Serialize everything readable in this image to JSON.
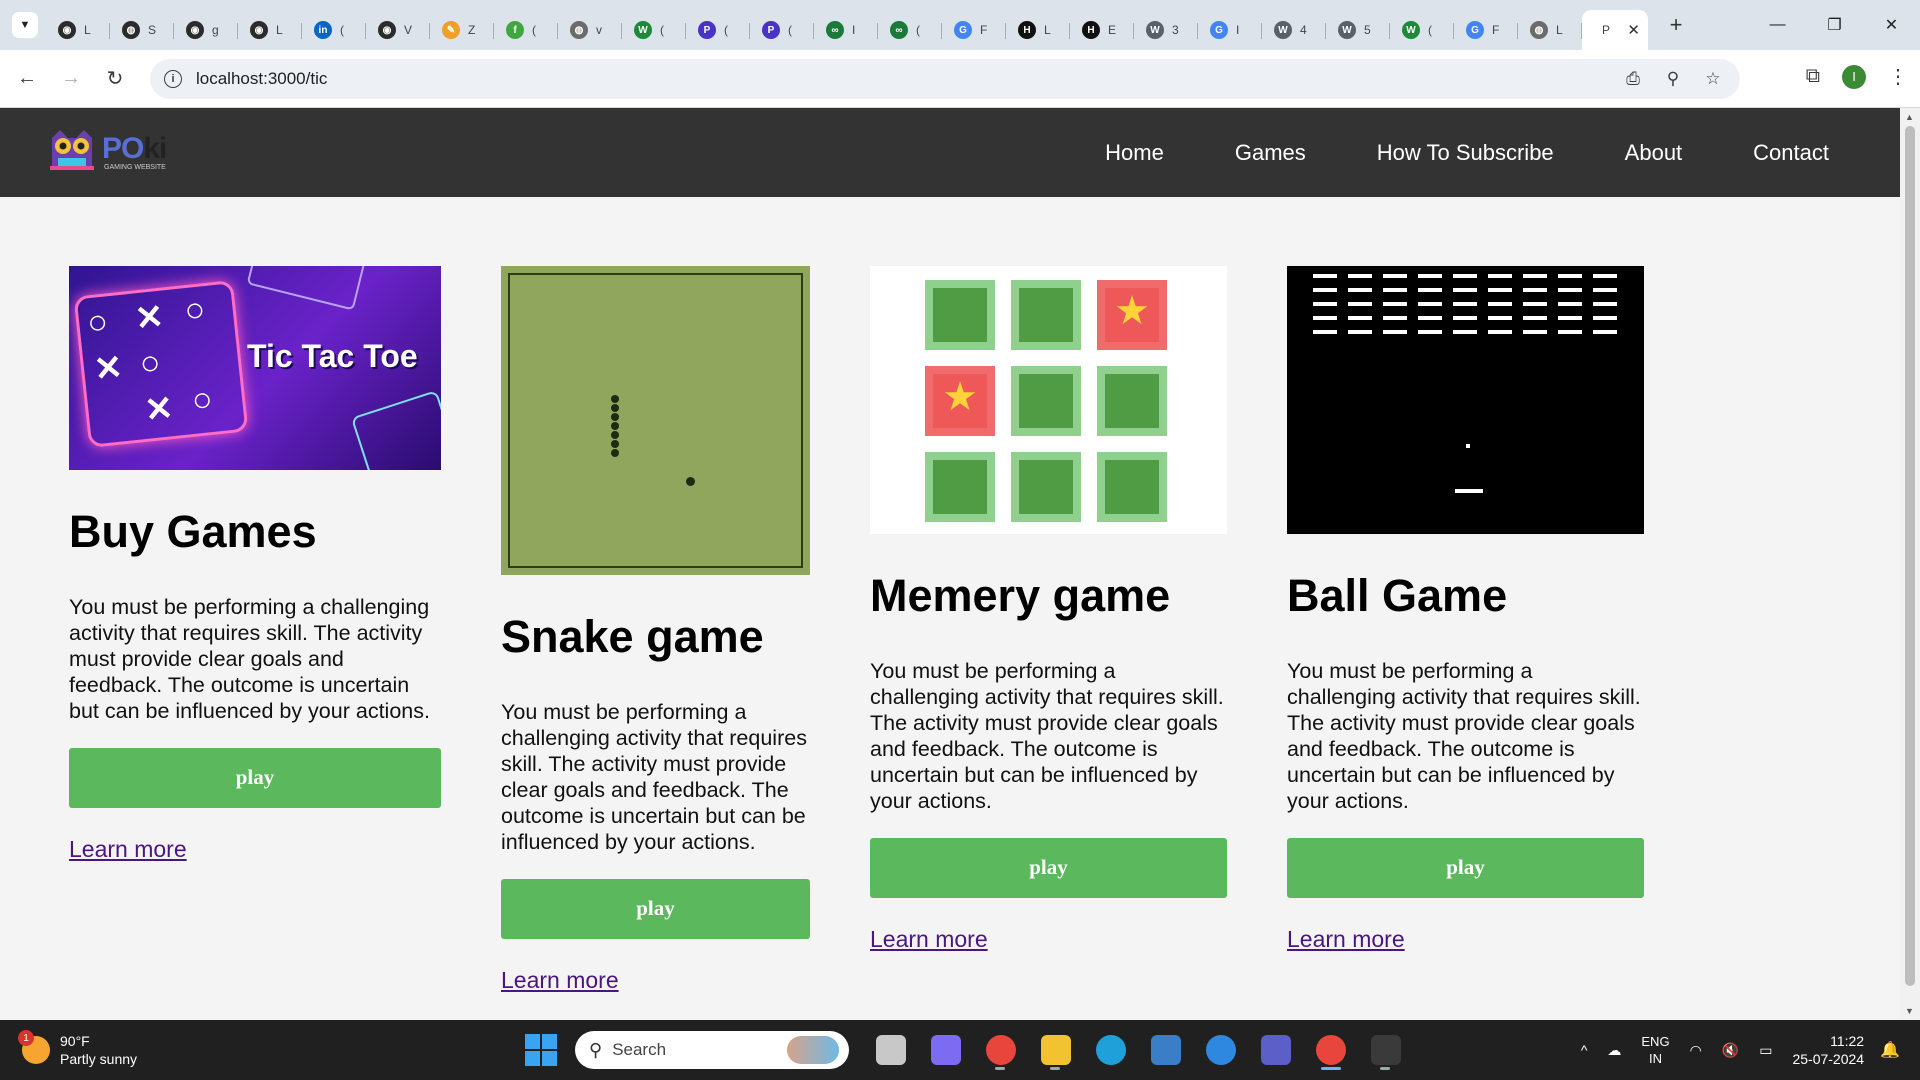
{
  "browser": {
    "tabs": [
      {
        "icon": "github-icon",
        "glyph": "◉",
        "title": "L",
        "color": "#2b2b2b"
      },
      {
        "icon": "globe-icon",
        "glyph": "◍",
        "title": "S",
        "color": "#2b2b2b"
      },
      {
        "icon": "github-icon",
        "glyph": "◉",
        "title": "g",
        "color": "#2b2b2b"
      },
      {
        "icon": "github-icon",
        "glyph": "◉",
        "title": "L",
        "color": "#2b2b2b"
      },
      {
        "icon": "linkedin-icon",
        "glyph": "in",
        "title": "(",
        "color": "#0a66c2"
      },
      {
        "icon": "github-icon",
        "glyph": "◉",
        "title": "V",
        "color": "#2b2b2b"
      },
      {
        "icon": "pen-icon",
        "glyph": "✎",
        "title": "Z",
        "color": "#f0a02a"
      },
      {
        "icon": "app-icon",
        "glyph": "f",
        "title": "(",
        "color": "#3fa73f"
      },
      {
        "icon": "globe-icon",
        "glyph": "◍",
        "title": "v",
        "color": "#6b6b6b"
      },
      {
        "icon": "w-icon",
        "glyph": "W",
        "title": "(",
        "color": "#1b8a3a"
      },
      {
        "icon": "p-icon",
        "glyph": "P",
        "title": "(",
        "color": "#4a32c8"
      },
      {
        "icon": "p-icon",
        "glyph": "P",
        "title": "(",
        "color": "#4a32c8"
      },
      {
        "icon": "link-icon",
        "glyph": "∞",
        "title": "I",
        "color": "#1b7a3a"
      },
      {
        "icon": "link-icon",
        "glyph": "∞",
        "title": "(",
        "color": "#1b7a3a"
      },
      {
        "icon": "google-icon",
        "glyph": "G",
        "title": "F",
        "color": "#4285f4"
      },
      {
        "icon": "hackerrank-icon",
        "glyph": "H",
        "title": "L",
        "color": "#111111"
      },
      {
        "icon": "hackerrank-icon",
        "glyph": "H",
        "title": "E",
        "color": "#111111"
      },
      {
        "icon": "wordpress-icon",
        "glyph": "W",
        "title": "3",
        "color": "#5a6168"
      },
      {
        "icon": "google-icon",
        "glyph": "G",
        "title": "I",
        "color": "#4285f4"
      },
      {
        "icon": "wordpress-icon",
        "glyph": "W",
        "title": "4",
        "color": "#5a6168"
      },
      {
        "icon": "wordpress-icon",
        "glyph": "W",
        "title": "5",
        "color": "#5a6168"
      },
      {
        "icon": "w-icon",
        "glyph": "W",
        "title": "(",
        "color": "#1b8a3a"
      },
      {
        "icon": "google-icon",
        "glyph": "G",
        "title": "F",
        "color": "#4285f4"
      },
      {
        "icon": "globe-icon",
        "glyph": "◍",
        "title": "L",
        "color": "#6b6b6b"
      }
    ],
    "active_tab": {
      "title": "P",
      "close_glyph": "✕"
    },
    "new_tab_glyph": "+",
    "window": {
      "minimize": "—",
      "restore": "❐",
      "close": "✕"
    },
    "nav": {
      "back": "←",
      "forward": "→",
      "reload": "↻"
    },
    "url": "localhost:3000/tic",
    "omni_icons": {
      "install": "⎙",
      "zoom": "⚲",
      "bookmark": "☆"
    },
    "toolbar_icons": {
      "extensions": "⧉",
      "profile": "I",
      "menu": "⋮"
    }
  },
  "site": {
    "logo": {
      "brand_a": "PO",
      "brand_b": "ki",
      "tagline": "GAMING WEBSITE"
    },
    "nav": [
      "Home",
      "Games",
      "How To Subscribe",
      "About",
      "Contact"
    ],
    "cards": [
      {
        "title": "Buy Games",
        "thumb_title": "Tic Tac Toe",
        "description": "You must be performing a challenging activity that requires skill. The activity must provide clear goals and feedback. The outcome is uncertain but can be influenced by your actions.",
        "button": "play",
        "link": "Learn more"
      },
      {
        "title": "Snake game",
        "description": "You must be performing a challenging activity that requires skill. The activity must provide clear goals and feedback. The outcome is uncertain but can be influenced by your actions.",
        "button": "play",
        "link": "Learn more"
      },
      {
        "title": "Memery game",
        "description": "You must be performing a challenging activity that requires skill. The activity must provide clear goals and feedback. The outcome is uncertain but can be influenced by your actions.",
        "button": "play",
        "link": "Learn more"
      },
      {
        "title": "Ball Game",
        "description": "You must be performing a challenging activity that requires skill. The activity must provide clear goals and feedback. The outcome is uncertain but can be influenced by your actions.",
        "button": "play",
        "link": "Learn more"
      }
    ],
    "accent": "#5cb85c",
    "nav_bg": "#333333"
  },
  "taskbar": {
    "weather": {
      "temp": "90°F",
      "desc": "Partly sunny",
      "badge": "1"
    },
    "search_label": "Search",
    "language": {
      "line1": "ENG",
      "line2": "IN"
    },
    "time": "11:22",
    "date": "25-07-2024",
    "tray_icons": {
      "chevron": "^",
      "cloud": "☁",
      "wifi": "◠",
      "volume": "🔇",
      "battery": "▭",
      "bell": "🔔"
    },
    "apps": [
      {
        "name": "task-view-icon",
        "color": "#c8c8c8"
      },
      {
        "name": "copilot-icon",
        "color": "#7d6bf2"
      },
      {
        "name": "chrome-icon",
        "color": "#e8453c"
      },
      {
        "name": "file-explorer-icon",
        "color": "#f2c230"
      },
      {
        "name": "edge-icon",
        "color": "#1fa0d8"
      },
      {
        "name": "mysql-workbench-icon",
        "color": "#3a7ec8"
      },
      {
        "name": "help-icon",
        "color": "#2f88e0"
      },
      {
        "name": "teams-icon",
        "color": "#5b5fc7"
      },
      {
        "name": "chrome-profile-icon",
        "color": "#e8453c"
      },
      {
        "name": "terminal-icon",
        "color": "#3a3a3a"
      }
    ]
  }
}
